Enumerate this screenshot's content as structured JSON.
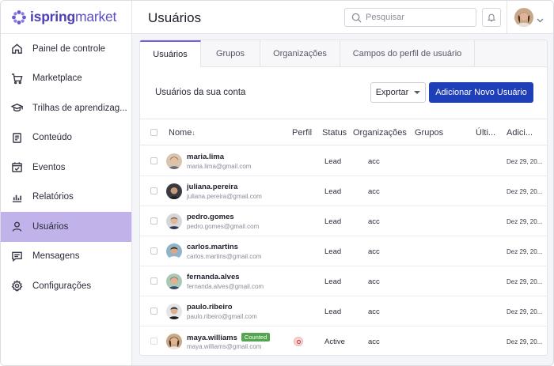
{
  "app": {
    "logo_bold": "ispring",
    "logo_light": "market"
  },
  "header": {
    "title": "Usuários",
    "search_placeholder": "Pesquisar"
  },
  "sidebar": {
    "items": [
      {
        "label": "Painel de controle",
        "icon": "home-icon"
      },
      {
        "label": "Marketplace",
        "icon": "cart-icon"
      },
      {
        "label": "Trilhas de aprendizag...",
        "icon": "graduation-cap-icon"
      },
      {
        "label": "Conteúdo",
        "icon": "document-icon"
      },
      {
        "label": "Eventos",
        "icon": "calendar-icon"
      },
      {
        "label": "Relatórios",
        "icon": "bar-chart-icon"
      },
      {
        "label": "Usuários",
        "icon": "user-icon",
        "active": true
      },
      {
        "label": "Mensagens",
        "icon": "message-icon"
      },
      {
        "label": "Configurações",
        "icon": "gear-icon"
      }
    ]
  },
  "tabs": [
    {
      "label": "Usuários",
      "active": true
    },
    {
      "label": "Grupos"
    },
    {
      "label": "Organizações"
    },
    {
      "label": "Campos do perfil de usuário"
    }
  ],
  "toolbar": {
    "account_label": "Usuários da sua conta",
    "export_label": "Exportar",
    "add_label": "Adicionar Novo Usuário"
  },
  "table": {
    "columns": {
      "name": "Nome",
      "sort_arrow": "↓",
      "profile": "Perfil",
      "status": "Status",
      "orgs": "Organizações",
      "groups": "Grupos",
      "last": "Últi...",
      "added": "Adici..."
    },
    "rows": [
      {
        "name": "maria.lima",
        "email": "maria.lima@gmail.com",
        "status": "Lead",
        "org": "acc",
        "date": "Dez 29, 20..."
      },
      {
        "name": "juliana.pereira",
        "email": "juliana.pereira@gmail.com",
        "status": "Lead",
        "org": "acc",
        "date": "Dez 29, 20..."
      },
      {
        "name": "pedro.gomes",
        "email": "pedro.gomes@gmail.com",
        "status": "Lead",
        "org": "acc",
        "date": "Dez 29, 20..."
      },
      {
        "name": "carlos.martins",
        "email": "carlos.martins@gmail.com",
        "status": "Lead",
        "org": "acc",
        "date": "Dez 29, 20..."
      },
      {
        "name": "fernanda.alves",
        "email": "fernanda.alves@gmail.com",
        "status": "Lead",
        "org": "acc",
        "date": "Dez 29, 20..."
      },
      {
        "name": "paulo.ribeiro",
        "email": "paulo.ribeiro@gmail.com",
        "status": "Lead",
        "org": "acc",
        "date": "Dez 29, 20..."
      },
      {
        "name": "maya.williams",
        "email": "maya.williams@gmail.com",
        "status": "Active",
        "org": "acc",
        "date": "Dez 29, 20...",
        "badge": "Counted"
      }
    ]
  },
  "colors": {
    "accent": "#1f3fb8",
    "active_nav": "#c1b3e9",
    "tab_indicator": "#7a5fd6",
    "badge": "#53a64f"
  }
}
